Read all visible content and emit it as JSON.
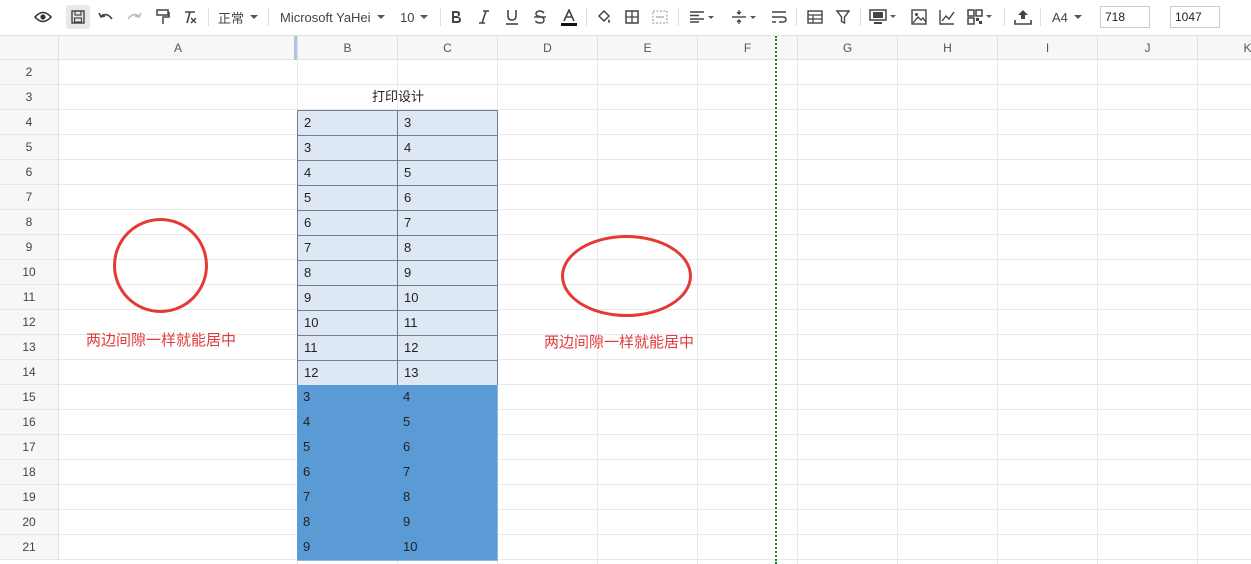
{
  "toolbar": {
    "style_label": "正常",
    "font_label": "Microsoft YaHei",
    "size_label": "10",
    "paper_label": "A4",
    "width_value": "718",
    "height_value": "1047"
  },
  "columns": [
    "A",
    "B",
    "C",
    "D",
    "E",
    "F",
    "G",
    "H",
    "I",
    "J",
    "K"
  ],
  "rows": [
    "2",
    "3",
    "4",
    "5",
    "6",
    "7",
    "8",
    "9",
    "10",
    "11",
    "12",
    "13",
    "14",
    "15",
    "16",
    "17",
    "18",
    "19",
    "20",
    "21"
  ],
  "table": {
    "title": "打印设计",
    "light_rows": [
      [
        "2",
        "3"
      ],
      [
        "3",
        "4"
      ],
      [
        "4",
        "5"
      ],
      [
        "5",
        "6"
      ],
      [
        "6",
        "7"
      ],
      [
        "7",
        "8"
      ],
      [
        "8",
        "9"
      ],
      [
        "9",
        "10"
      ],
      [
        "10",
        "11"
      ],
      [
        "11",
        "12"
      ],
      [
        "12",
        "13"
      ]
    ],
    "dark_rows": [
      [
        "3",
        "4"
      ],
      [
        "4",
        "5"
      ],
      [
        "5",
        "6"
      ],
      [
        "6",
        "7"
      ],
      [
        "7",
        "8"
      ],
      [
        "8",
        "9"
      ],
      [
        "9",
        "10"
      ]
    ]
  },
  "annotations": {
    "left_note": "两边间隙一样就能居中",
    "right_note": "两边间隙一样就能居中",
    "color": "#e53935"
  },
  "colors": {
    "light_fill": "#dde8f4",
    "dark_fill": "#5b9bd5",
    "page_break": "#1a8a2e"
  }
}
